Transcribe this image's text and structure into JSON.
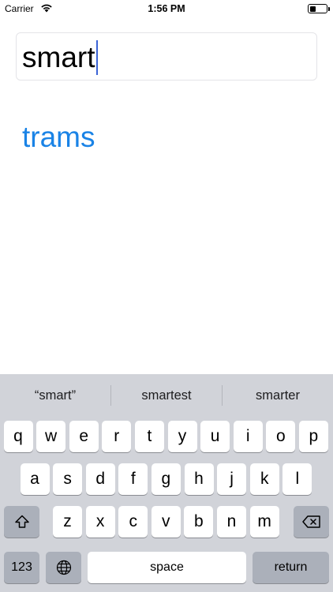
{
  "status_bar": {
    "carrier": "Carrier",
    "time": "1:56 PM",
    "battery_level": 0.35
  },
  "text_field": {
    "value": "smart"
  },
  "reversed": {
    "text": "trams",
    "color": "#1a83e6"
  },
  "keyboard": {
    "suggestions": [
      "“smart”",
      "smartest",
      "smarter"
    ],
    "row1": [
      "q",
      "w",
      "e",
      "r",
      "t",
      "y",
      "u",
      "i",
      "o",
      "p"
    ],
    "row2": [
      "a",
      "s",
      "d",
      "f",
      "g",
      "h",
      "j",
      "k",
      "l"
    ],
    "row3": [
      "z",
      "x",
      "c",
      "v",
      "b",
      "n",
      "m"
    ],
    "numbers_label": "123",
    "space_label": "space",
    "return_label": "return",
    "icons": {
      "shift": "shift-icon",
      "delete": "backspace-icon",
      "globe": "globe-icon"
    }
  }
}
